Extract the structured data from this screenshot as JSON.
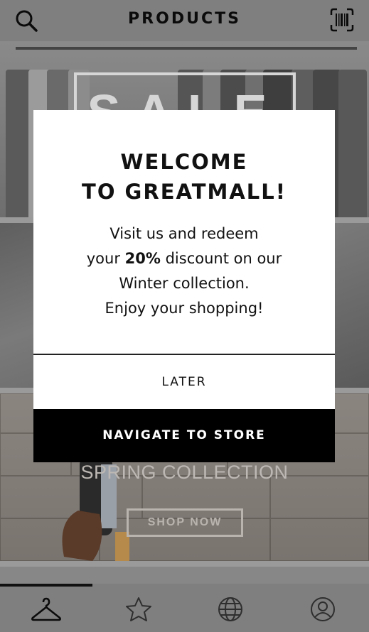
{
  "header": {
    "title": "PRODUCTS",
    "left_icon": "search-icon",
    "right_icon": "barcode-scan-icon"
  },
  "banners": {
    "sale": {
      "text": "SALE"
    },
    "spring": {
      "title": "SPRING COLLECTION",
      "button": "SHOP NOW"
    }
  },
  "modal": {
    "heading_line1": "WELCOME",
    "heading_line2": "TO GREATMALL!",
    "body_line1": "Visit us and redeem",
    "body_line2_prefix": "your ",
    "body_line2_bold": "20%",
    "body_line2_suffix": " discount on our",
    "body_line3": "Winter collection.",
    "body_line4": "Enjoy your shopping!",
    "later_label": "LATER",
    "navigate_label": "NAVIGATE TO STORE"
  },
  "nav": {
    "items": [
      {
        "icon": "hanger-icon",
        "active": true
      },
      {
        "icon": "star-icon",
        "active": false
      },
      {
        "icon": "globe-icon",
        "active": false
      },
      {
        "icon": "profile-icon",
        "active": false
      }
    ]
  },
  "colors": {
    "overlay": "#7f7f7f",
    "modal_bg": "#ffffff",
    "primary_button": "#000000",
    "text": "#111111"
  }
}
